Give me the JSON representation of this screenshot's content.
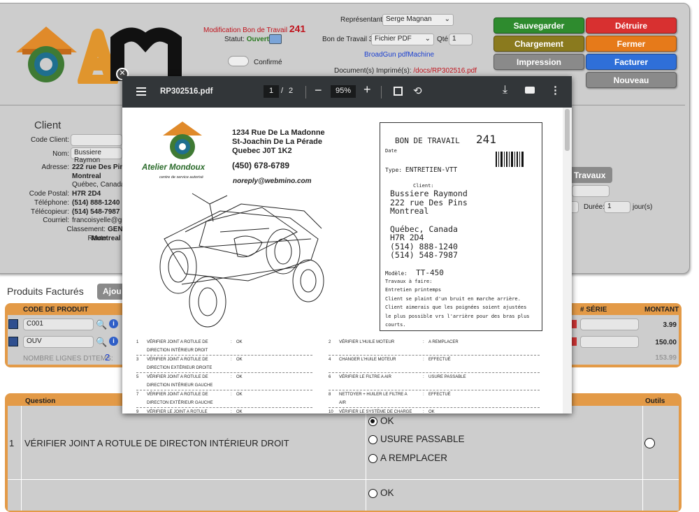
{
  "header": {
    "mod_label": "Modification Bon de Travail",
    "work_no": "241",
    "statut_label": "Statut:",
    "statut_value": "Ouvert",
    "confirme_label": "Confirmé",
    "representant_label": "Représentant:",
    "representant_value": "Serge Magnan",
    "bon3_label": "Bon de Travail 3:",
    "bon3_value": "Fichier PDF",
    "qte_label": "Qté:",
    "qte_value": "1",
    "broadgun": "BroadGun pdfMachine",
    "docs_label": "Document(s) Imprimé(s):",
    "docs_value": "/docs/RP302516.pdf"
  },
  "buttons": {
    "sauvegarder": "Sauvegarder",
    "detruire": "Détruire",
    "chargement": "Chargement",
    "fermer": "Fermer",
    "impression": "Impression",
    "facturer": "Facturer",
    "nouveau": "Nouveau",
    "travaux": "Travaux",
    "ajouter": "Ajou"
  },
  "colors": {
    "green": "#2e8b2e",
    "olive": "#8a7a1e",
    "red": "#d83030",
    "orange": "#e67a1a",
    "blue": "#2f6fd8",
    "gray": "#8a8a8a",
    "table_header": "#e39a47"
  },
  "client": {
    "title": "Client",
    "code_label": "Code Client:",
    "nom_label": "Nom:",
    "nom_value": "Bussiere Raymon",
    "adresse_label": "Adresse:",
    "adresse_l1": "222 rue Des Pins",
    "adresse_l2": "Montreal",
    "adresse_l3": "Québec, Canada",
    "cp_label": "Code Postal:",
    "cp_value": "H7R 2D4",
    "tel_label": "Téléphone:",
    "tel_value": "(514) 888-1240",
    "fax_label": "Télécopieur:",
    "fax_value": "(514) 548-7987",
    "courriel_label": "Courriel:",
    "courriel_value": "francoisyelle@gn",
    "classement_label": "Classement:",
    "classement_value": "GEN",
    "route_label": "Route:",
    "route_value": "Montreal"
  },
  "duree": {
    "label": "Durée:",
    "value": "1",
    "unit": "jour(s)"
  },
  "produits": {
    "title": "Produits Facturés",
    "col_code": "CODE DE PRODUIT",
    "col_serie": "# SÉRIE",
    "col_montant": "MONTANT",
    "rows": [
      {
        "code": "C001",
        "montant": "3.99"
      },
      {
        "code": "OUV",
        "montant": "150.00"
      }
    ],
    "nb_label": "NOMBRE LIGNES D'ITEMS:",
    "nb_value": "2",
    "total": "153.99"
  },
  "questions": {
    "col_question": "Question",
    "col_outils": "Outils",
    "rows": [
      {
        "num": "1",
        "text": "VÉRIFIER JOINT A ROTULE DE DIRECTON INTÉRIEUR DROIT",
        "options": [
          "OK",
          "USURE PASSABLE",
          "A REMPLACER"
        ]
      },
      {
        "num": "",
        "text": "",
        "options": [
          "OK"
        ]
      }
    ]
  },
  "pdf": {
    "filename": "RP302516.pdf",
    "page": "1",
    "pages": "2",
    "zoom": "95%",
    "company_addr1": "1234 Rue De La Madonne",
    "company_addr2": "St-Joachin De La Pérade",
    "company_addr3": "Quebec J0T 1K2",
    "company_phone": "(450) 678-6789",
    "company_email": "noreply@webmino.com",
    "logo_text": "Atelier Mondoux",
    "logo_sub": "centre de service autorisé",
    "bon_title": "BON DE TRAVAIL",
    "bon_no": "241",
    "date_label": "Date",
    "type_label": "Type:",
    "type_value": "ENTRETIEN-VTT",
    "client_label": "Client:",
    "client_l1": "Bussiere Raymond",
    "client_l2": "222 rue Des Pins",
    "client_l3": "Montreal",
    "client_l4": "Québec, Canada",
    "client_l5": "H7R 2D4",
    "client_l6": "(514) 888-1240",
    "client_l7": "(514) 548-7987",
    "modele_label": "Modèle:",
    "modele_value": "TT-450",
    "travaux_label": "Travaux à faire:",
    "travaux_l1": "Entretien printemps",
    "travaux_l2": "Client se plaint d'un bruit en marche arrière.",
    "travaux_l3": "Client aimerais que les poignées soient ajustées",
    "travaux_l4": "le plus possible vrs l'arrière pour des bras plus",
    "travaux_l5": "courts.",
    "checklist": [
      {
        "n": "1",
        "t1": "VÉRIFIER JOINT A ROTULE DE",
        "t2": "DIRECTION INTÉRIEUR DROIT",
        "v": "OK"
      },
      {
        "n": "2",
        "t1": "VÉRIFIER L'HUILE MOTEUR",
        "t2": "",
        "v": "A REMPLACER"
      },
      {
        "n": "3",
        "t1": "VÉRIFIER JOINT A ROTULE DE",
        "t2": "DIRECTION EXTÉRIEUR DROITE",
        "v": "OK"
      },
      {
        "n": "4",
        "t1": "CHANGER L'HUILE MOTEUR",
        "t2": "",
        "v": "EFFECTUÉ"
      },
      {
        "n": "5",
        "t1": "VÉRIFIER JOINT A ROTULE DE",
        "t2": "DIRECTION INTÉRIEUR GAUCHE",
        "v": "OK"
      },
      {
        "n": "6",
        "t1": "VÉRIFIER LE FILTRE A AIR",
        "t2": "",
        "v": "USURE PASSABLE"
      },
      {
        "n": "7",
        "t1": "VÉRIFIER JOINT A ROTULE DE",
        "t2": "DIRECTON EXTÉRIEUR GAUCHE",
        "v": "OK"
      },
      {
        "n": "8",
        "t1": "NETTOYER + HUILER LE FILTRE A",
        "t2": "AIR",
        "v": "EFFECTUÉ"
      },
      {
        "n": "9",
        "t1": "VÉRIFIER LE JOINT A ROTULE",
        "t2": "",
        "v": "OK"
      },
      {
        "n": "10",
        "t1": "VÉRIFIER LE SYSTÈME DE CHARGE",
        "t2": "",
        "v": "OK"
      }
    ]
  }
}
